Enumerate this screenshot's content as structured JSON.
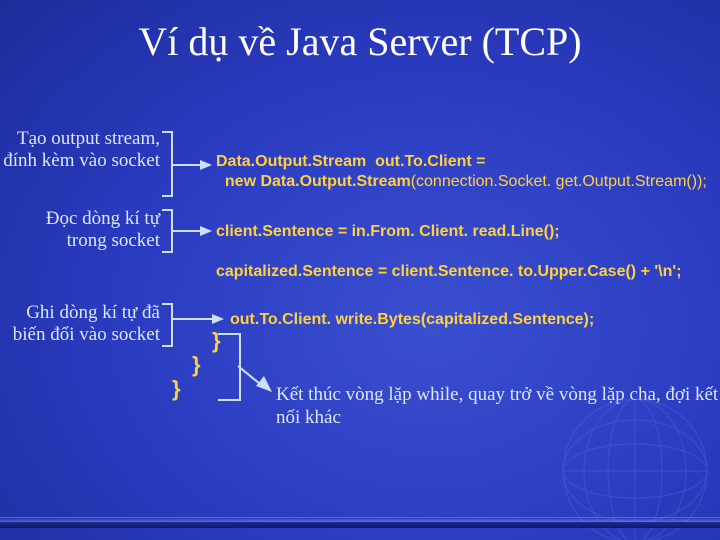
{
  "title": "Ví dụ về Java Server (TCP)",
  "annot1": "Tạo output stream,\nđính kèm vào\nsocket",
  "annot2": "Đọc dòng kí tự\ntrong socket",
  "annot3": "Ghi dòng kí tự đã\nbiến đổi vào socket",
  "code1a": "Data.Output.Stream  out.To.Client =",
  "code1b": "  new Data.Output.Stream",
  "code1c": "(connection.Socket. get.Output.Stream());",
  "code2": "client.Sentence = in.From. Client. read.Line();",
  "code3": "capitalized.Sentence = client.Sentence. to.Upper.Case() + '\\n';",
  "code4": "out.To.Client. write.Bytes(capitalized.Sentence);",
  "brace1": "}",
  "brace2": "}",
  "brace3": "}",
  "comment": "Kết thúc vòng lặp while,\nquay trở về vòng lặp cha,\nđợi kết nối khác"
}
